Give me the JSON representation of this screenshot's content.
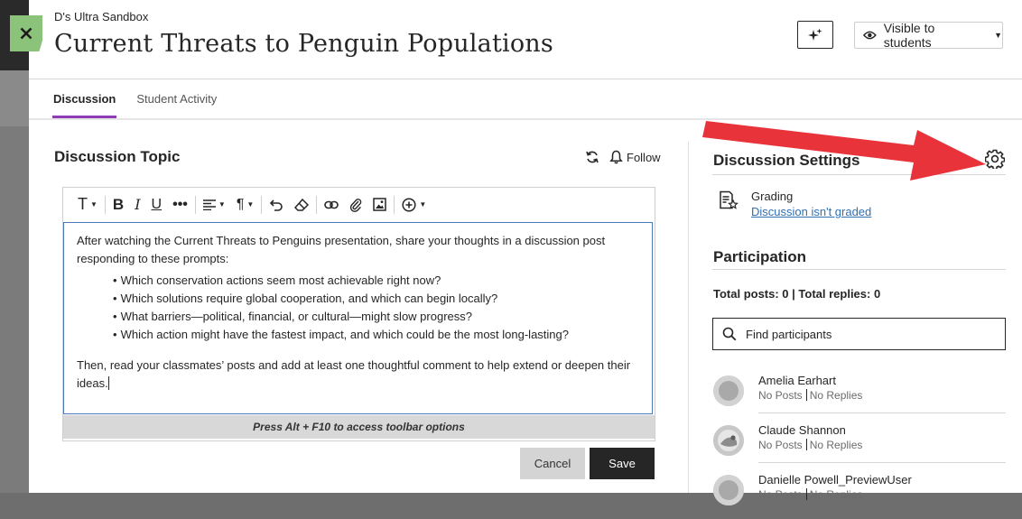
{
  "header": {
    "course_name": "D's Ultra Sandbox",
    "title": "Current Threats to Penguin Populations",
    "visibility_label": "Visible to students"
  },
  "tabs": [
    {
      "label": "Discussion",
      "active": true
    },
    {
      "label": "Student Activity",
      "active": false
    }
  ],
  "topic": {
    "heading": "Discussion Topic",
    "follow_label": "Follow",
    "intro": "After watching the Current Threats to Penguins presentation, share your thoughts in a discussion post responding to these prompts:",
    "bullets": [
      "Which conservation actions seem most achievable right now?",
      "Which solutions require global cooperation, and which can begin locally?",
      "What barriers—political, financial, or cultural—might slow progress?",
      "Which action might have the fastest impact, and which could be the most long-lasting?"
    ],
    "outro": "Then, read your classmates’ posts and add at least one thoughtful comment to help extend or deepen their ideas.",
    "toolbar_hint": "Press Alt + F10 to access toolbar options",
    "cancel_label": "Cancel",
    "save_label": "Save"
  },
  "settings": {
    "heading": "Discussion Settings",
    "grading_label": "Grading",
    "grading_link": "Discussion isn't graded"
  },
  "participation": {
    "heading": "Participation",
    "totals": "Total posts: 0 | Total replies: 0",
    "search_placeholder": "Find participants",
    "participants": [
      {
        "name": "Amelia Earhart",
        "posts": "No Posts",
        "replies": "No Replies"
      },
      {
        "name": "Claude Shannon",
        "posts": "No Posts",
        "replies": "No Replies"
      },
      {
        "name": "Danielle Powell_PreviewUser",
        "posts": "No Posts",
        "replies": "No Replies"
      }
    ]
  },
  "colors": {
    "accent_tab": "#8c3cb5",
    "close_tab": "#8bc37a",
    "link": "#2f6fb2",
    "annotation_arrow": "#e8333a"
  },
  "icons": [
    "close-icon",
    "sparkle-icon",
    "eye-icon",
    "refresh-icon",
    "bell-icon",
    "gear-icon",
    "grading-icon",
    "search-icon"
  ]
}
